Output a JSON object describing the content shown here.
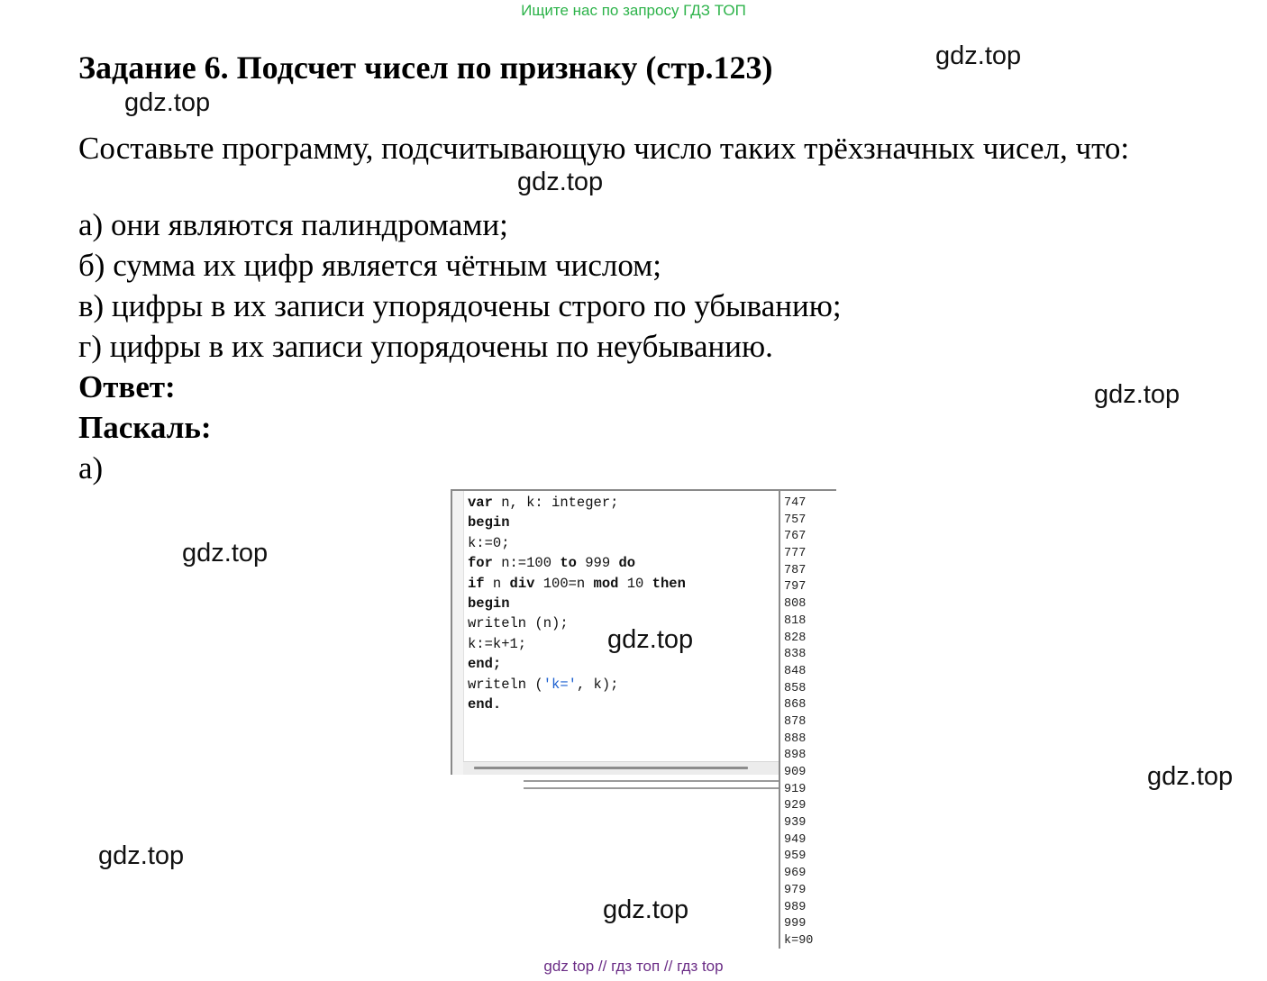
{
  "banner": "Ищите нас по запросу ГДЗ ТОП",
  "title": "Задание 6. Подсчет чисел по признаку (стр.123)",
  "task": {
    "intro": "Составьте программу, подсчитывающую число таких трёхзначных чисел, что:",
    "items": [
      "а) они являются палиндромами;",
      "б) сумма их цифр является чётным числом;",
      "в) цифры в их записи упорядочены строго по убыванию;",
      "г) цифры в их записи упорядочены по неубыванию."
    ]
  },
  "answer_label": "Ответ:",
  "language_label": "Паскаль:",
  "part_label": "а)",
  "code_lines": [
    [
      {
        "t": "var",
        "kw": true
      },
      {
        "t": " n, k: integer;"
      }
    ],
    [
      {
        "t": "begin",
        "kw": true
      }
    ],
    [
      {
        "t": "k:=0;"
      }
    ],
    [
      {
        "t": "for",
        "kw": true
      },
      {
        "t": " n:=100 "
      },
      {
        "t": "to",
        "kw": true
      },
      {
        "t": " 999 "
      },
      {
        "t": "do",
        "kw": true
      }
    ],
    [
      {
        "t": "if",
        "kw": true
      },
      {
        "t": " n "
      },
      {
        "t": "div",
        "kw": true
      },
      {
        "t": " 100=n "
      },
      {
        "t": "mod",
        "kw": true
      },
      {
        "t": " 10 "
      },
      {
        "t": "then",
        "kw": true
      }
    ],
    [
      {
        "t": "begin",
        "kw": true
      }
    ],
    [
      {
        "t": "writeln (n);"
      }
    ],
    [
      {
        "t": "k:=k+1;"
      }
    ],
    [
      {
        "t": "end;",
        "kw": true
      }
    ],
    [
      {
        "t": "writeln ("
      },
      {
        "t": "'k='",
        "str": true
      },
      {
        "t": ", k);"
      }
    ],
    [
      {
        "t": "end.",
        "kw": true
      }
    ]
  ],
  "output_lines": [
    "747",
    "757",
    "767",
    "777",
    "787",
    "797",
    "808",
    "818",
    "828",
    "838",
    "848",
    "858",
    "868",
    "878",
    "888",
    "898",
    "909",
    "919",
    "929",
    "939",
    "949",
    "959",
    "969",
    "979",
    "989",
    "999",
    "k=90"
  ],
  "watermarks": [
    "gdz.top",
    "gdz.top",
    "gdz.top",
    "gdz.top",
    "gdz.top",
    "gdz.top",
    "gdz.top",
    "gdz.top",
    "gdz.top"
  ],
  "footer": "gdz top  //  гдз топ  //  гдз top"
}
